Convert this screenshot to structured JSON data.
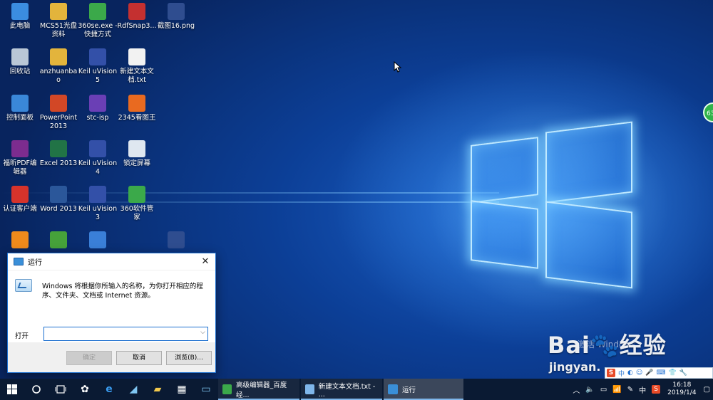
{
  "desktop": {
    "icons": [
      {
        "label": "此电脑",
        "icon": "computer-icon",
        "color": "#3b8de0"
      },
      {
        "label": "MCS51光盘资料",
        "icon": "folder-icon",
        "color": "#e3b43c"
      },
      {
        "label": "360se.exe - 快捷方式",
        "icon": "browser-icon",
        "color": "#3ba94a"
      },
      {
        "label": "RdfSnap3...",
        "icon": "snap-app-icon",
        "color": "#c43030"
      },
      {
        "label": "截图16.png",
        "icon": "image-file-icon",
        "color": "#2f4d8f"
      },
      {
        "label": "回收站",
        "icon": "recycle-bin-icon",
        "color": "#b9c7d6"
      },
      {
        "label": "anzhuanbao",
        "icon": "folder-icon",
        "color": "#e3b43c"
      },
      {
        "label": "Keil uVision5",
        "icon": "keil-icon",
        "color": "#3350a8"
      },
      {
        "label": "新建文本文档.txt",
        "icon": "text-file-icon",
        "color": "#f2f2f2"
      },
      {
        "label": "控制面板",
        "icon": "control-panel-icon",
        "color": "#3a87d8"
      },
      {
        "label": "PowerPoint 2013",
        "icon": "powerpoint-icon",
        "color": "#d24726"
      },
      {
        "label": "stc-isp",
        "icon": "stc-isp-icon",
        "color": "#6a3fb5"
      },
      {
        "label": "2345看图王",
        "icon": "image-viewer-icon",
        "color": "#e96a20"
      },
      {
        "label": "福昕PDF编辑器",
        "icon": "pdf-editor-icon",
        "color": "#7c2c8f"
      },
      {
        "label": "Excel 2013",
        "icon": "excel-icon",
        "color": "#217346"
      },
      {
        "label": "Keil uVision4",
        "icon": "keil-icon",
        "color": "#3350a8"
      },
      {
        "label": "锁定屏幕",
        "icon": "lock-screen-icon",
        "color": "#dfe7f0"
      },
      {
        "label": "认证客户端",
        "icon": "auth-client-icon",
        "color": "#d6332b"
      },
      {
        "label": "Word 2013",
        "icon": "word-icon",
        "color": "#2b579a"
      },
      {
        "label": "Keil uVision3",
        "icon": "keil-icon",
        "color": "#3350a8"
      },
      {
        "label": "360软件管家",
        "icon": "software-manager-icon",
        "color": "#3ba94a"
      },
      {
        "label": "",
        "icon": "app-icon",
        "color": "#f08a1c"
      },
      {
        "label": "",
        "icon": "app-icon",
        "color": "#46a23a"
      },
      {
        "label": "",
        "icon": "app-icon",
        "color": "#3a7fd8"
      },
      {
        "label": "",
        "icon": "app-icon",
        "color": "#2f4d8f"
      }
    ],
    "float_badge": "63"
  },
  "run_dialog": {
    "title": "运行",
    "close": "✕",
    "description": "Windows 将根据你所输入的名称，为你打开相应的程序、文件夹、文档或 Internet 资源。",
    "open_label": "打开",
    "input_value": "",
    "dropdown": "⌵",
    "ok_label": "确定",
    "cancel_label": "取消",
    "browse_label": "浏览(B)..."
  },
  "taskbar": {
    "apps": [
      {
        "label": "高级编辑器_百度经...",
        "icon": "browser-icon",
        "color": "#3ba94a",
        "active": false
      },
      {
        "label": "新建文本文档.txt - ...",
        "icon": "notepad-icon",
        "color": "#7fb6ea",
        "active": false
      },
      {
        "label": "运行",
        "icon": "run-icon",
        "color": "#3a8fd8",
        "active": true
      }
    ],
    "tray": {
      "ime": "中",
      "time": "16:18",
      "date": "2019/1/4"
    }
  },
  "watermark": {
    "brand": "Bai",
    "brand2": "经验",
    "url": "jingyan.",
    "activate_hint": "激活 Windows"
  },
  "ime_bar": {
    "s": "S",
    "lang": "中"
  }
}
